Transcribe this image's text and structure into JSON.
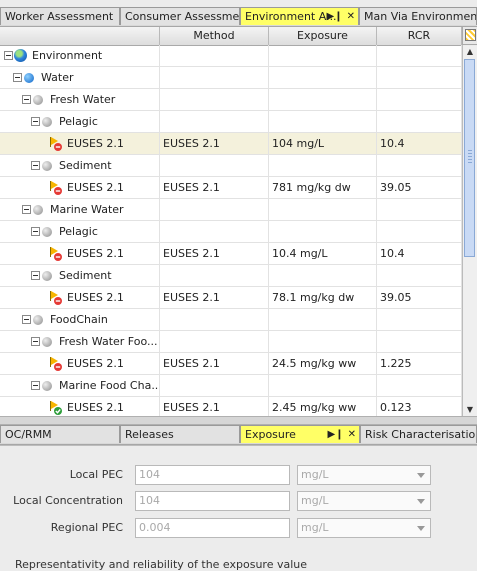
{
  "top_tabs": [
    {
      "label": "Worker Assessment",
      "active": false
    },
    {
      "label": "Consumer Assessment",
      "active": false
    },
    {
      "label": "Environment A...",
      "active": true
    },
    {
      "label": "Man Via Environment...",
      "active": false
    }
  ],
  "grid": {
    "columns": [
      "",
      "Method",
      "Exposure",
      "RCR"
    ],
    "rows": [
      {
        "level": 0,
        "type": "group",
        "icon": "globe-icon",
        "name": "Environment",
        "method": "",
        "exposure": "",
        "rcr": ""
      },
      {
        "level": 1,
        "type": "group",
        "icon": "blue-dot-icon",
        "name": "Water",
        "method": "",
        "exposure": "",
        "rcr": ""
      },
      {
        "level": 2,
        "type": "group",
        "icon": "grey-dot-icon",
        "name": "Fresh Water",
        "method": "",
        "exposure": "",
        "rcr": ""
      },
      {
        "level": 3,
        "type": "group",
        "icon": "grey-dot-icon",
        "name": "Pelagic",
        "method": "",
        "exposure": "",
        "rcr": ""
      },
      {
        "level": 4,
        "type": "leaf",
        "status": "fail",
        "name": "EUSES 2.1",
        "method": "EUSES 2.1",
        "exposure": "104 mg/L",
        "rcr": "10.4",
        "selected": true
      },
      {
        "level": 3,
        "type": "group",
        "icon": "grey-dot-icon",
        "name": "Sediment",
        "method": "",
        "exposure": "",
        "rcr": ""
      },
      {
        "level": 4,
        "type": "leaf",
        "status": "fail",
        "name": "EUSES 2.1",
        "method": "EUSES 2.1",
        "exposure": "781 mg/kg dw",
        "rcr": "39.05"
      },
      {
        "level": 2,
        "type": "group",
        "icon": "grey-dot-icon",
        "name": "Marine Water",
        "method": "",
        "exposure": "",
        "rcr": ""
      },
      {
        "level": 3,
        "type": "group",
        "icon": "grey-dot-icon",
        "name": "Pelagic",
        "method": "",
        "exposure": "",
        "rcr": ""
      },
      {
        "level": 4,
        "type": "leaf",
        "status": "fail",
        "name": "EUSES 2.1",
        "method": "EUSES 2.1",
        "exposure": "10.4 mg/L",
        "rcr": "10.4"
      },
      {
        "level": 3,
        "type": "group",
        "icon": "grey-dot-icon",
        "name": "Sediment",
        "method": "",
        "exposure": "",
        "rcr": ""
      },
      {
        "level": 4,
        "type": "leaf",
        "status": "fail",
        "name": "EUSES 2.1",
        "method": "EUSES 2.1",
        "exposure": "78.1 mg/kg dw",
        "rcr": "39.05"
      },
      {
        "level": 2,
        "type": "group",
        "icon": "grey-dot-icon",
        "name": "FoodChain",
        "method": "",
        "exposure": "",
        "rcr": ""
      },
      {
        "level": 3,
        "type": "group",
        "icon": "grey-dot-icon",
        "name": "Fresh Water Foo...",
        "method": "",
        "exposure": "",
        "rcr": ""
      },
      {
        "level": 4,
        "type": "leaf",
        "status": "fail",
        "name": "EUSES 2.1",
        "method": "EUSES 2.1",
        "exposure": "24.5 mg/kg ww",
        "rcr": "1.225"
      },
      {
        "level": 3,
        "type": "group",
        "icon": "grey-dot-icon",
        "name": "Marine Food Cha...",
        "method": "",
        "exposure": "",
        "rcr": ""
      },
      {
        "level": 4,
        "type": "leaf",
        "status": "ok",
        "name": "EUSES 2.1",
        "method": "EUSES 2.1",
        "exposure": "2.45 mg/kg ww",
        "rcr": "0.123"
      }
    ]
  },
  "bottom_tabs": [
    {
      "label": "OC/RMM",
      "active": false
    },
    {
      "label": "Releases",
      "active": false
    },
    {
      "label": "Exposure",
      "active": true
    },
    {
      "label": "Risk Characterisation",
      "active": false
    }
  ],
  "form": {
    "fields": [
      {
        "label": "Local PEC",
        "value": "104",
        "unit": "mg/L"
      },
      {
        "label": "Local Concentration",
        "value": "104",
        "unit": "mg/L"
      },
      {
        "label": "Regional PEC",
        "value": "0.004",
        "unit": "mg/L"
      }
    ],
    "note": "Representativity and reliability of the exposure value"
  },
  "colors": {
    "active_tab": "#ffff66",
    "selected_row": "#f4f1dc",
    "fail_badge": "#e53935",
    "ok_badge": "#2e9d3a",
    "flag": "#f7b500"
  }
}
